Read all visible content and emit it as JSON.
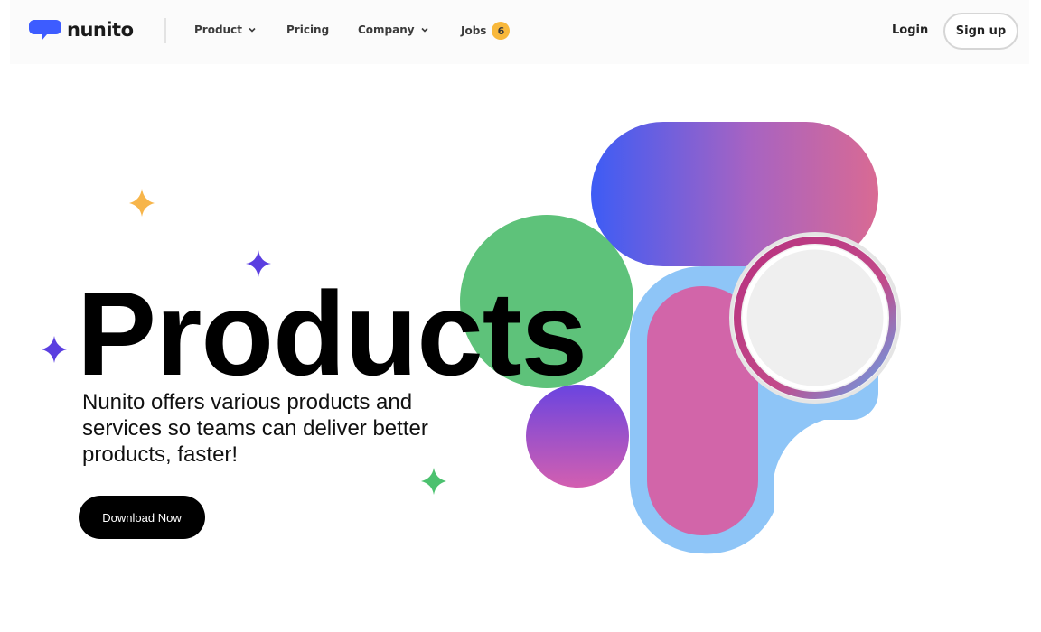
{
  "brand": {
    "name": "nunito",
    "logo_icon": "chat-bubble-icon",
    "color": "#3d5cff"
  },
  "nav": {
    "items": [
      {
        "label": "Product",
        "has_dropdown": true
      },
      {
        "label": "Pricing",
        "has_dropdown": false
      },
      {
        "label": "Company",
        "has_dropdown": true
      },
      {
        "label": "Jobs",
        "badge": "6"
      }
    ],
    "login_label": "Login",
    "signup_label": "Sign up"
  },
  "hero": {
    "title": "Products",
    "subtitle": "Nunito offers various products and services so teams can deliver better products, faster!",
    "cta_label": "Download Now"
  },
  "colors": {
    "sparkle_orange": "#f7b54a",
    "sparkle_purple": "#5b3fe0",
    "sparkle_green": "#4cc16f",
    "green_circle": "#5ec27a",
    "light_blue": "#8ec5f7",
    "pink": "#d265a9",
    "badge": "#f8b83b"
  }
}
